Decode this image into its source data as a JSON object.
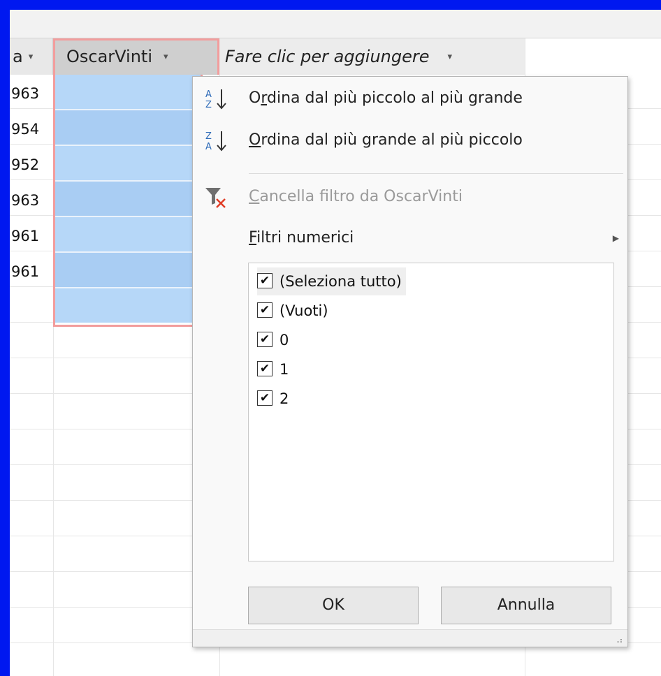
{
  "grid": {
    "prev_header_fragment": "a",
    "header_oscar": "OscarVinti",
    "header_add": "Fare clic per aggiungere",
    "header_arrow": "▾",
    "prev_values": [
      "963",
      "954",
      "952",
      "963",
      "961",
      "961"
    ]
  },
  "menu": {
    "sort_asc": {
      "u": "r",
      "pre": "O",
      "post": "dina dal più piccolo al più grande"
    },
    "sort_desc": {
      "u": "O",
      "pre": "",
      "post": "rdina dal più grande al più piccolo"
    },
    "clear_filter": {
      "u": "C",
      "post": "ancella filtro da OscarVinti"
    },
    "numeric_filters": {
      "u": "F",
      "post": "iltri numerici"
    },
    "submenu_arrow": "▶",
    "list_items": [
      "(Seleziona tutto)",
      "(Vuoti)",
      "0",
      "1",
      "2"
    ],
    "check_mark": "✔",
    "ok_label": "OK",
    "cancel_label": "Annulla",
    "grip": "⠠⠆"
  },
  "colors": {
    "frame": "#0018f0",
    "selection": "#b6d7f8",
    "selection_alt": "#a9cdf3",
    "selection_border": "#f29d9d"
  }
}
